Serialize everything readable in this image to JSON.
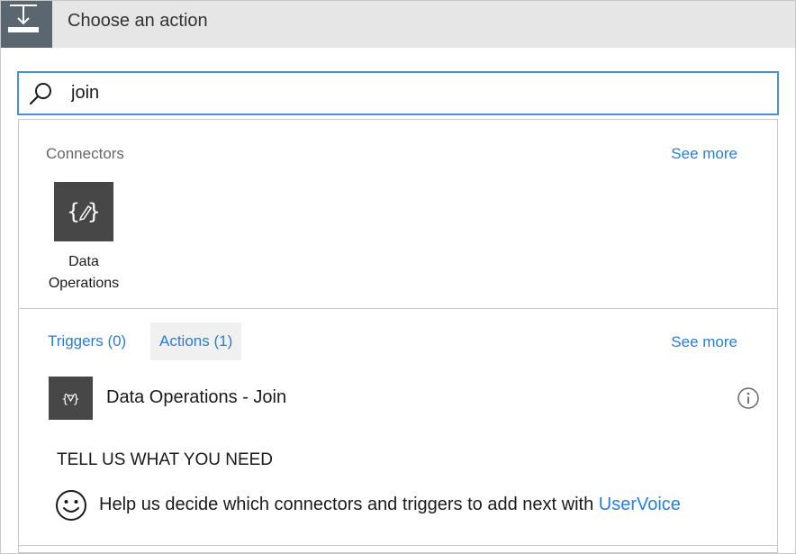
{
  "header": {
    "title": "Choose an action",
    "icon": "trigger-step-icon"
  },
  "search": {
    "value": "join",
    "icon": "search-icon"
  },
  "connectors": {
    "label": "Connectors",
    "see_more": "See more",
    "items": [
      {
        "label": "Data Operations",
        "icon": "data-operations-icon"
      }
    ]
  },
  "actions": {
    "tabs": [
      {
        "label": "Triggers (0)",
        "active": false
      },
      {
        "label": "Actions (1)",
        "active": true
      }
    ],
    "see_more": "See more",
    "items": [
      {
        "label": "Data Operations - Join",
        "icon": "data-operations-join-icon",
        "info_icon": "info-icon"
      }
    ]
  },
  "feedback": {
    "heading": "TELL US WHAT YOU NEED",
    "text": "Help us decide which connectors and triggers to add next with ",
    "link": "UserVoice",
    "icon": "smiley-icon"
  },
  "colors": {
    "header_bg": "#e6e6e6",
    "header_icon_bg": "#5a6670",
    "accent_link": "#2b7cd3",
    "search_border": "#4a90d9",
    "connector_icon_bg": "#474747"
  }
}
